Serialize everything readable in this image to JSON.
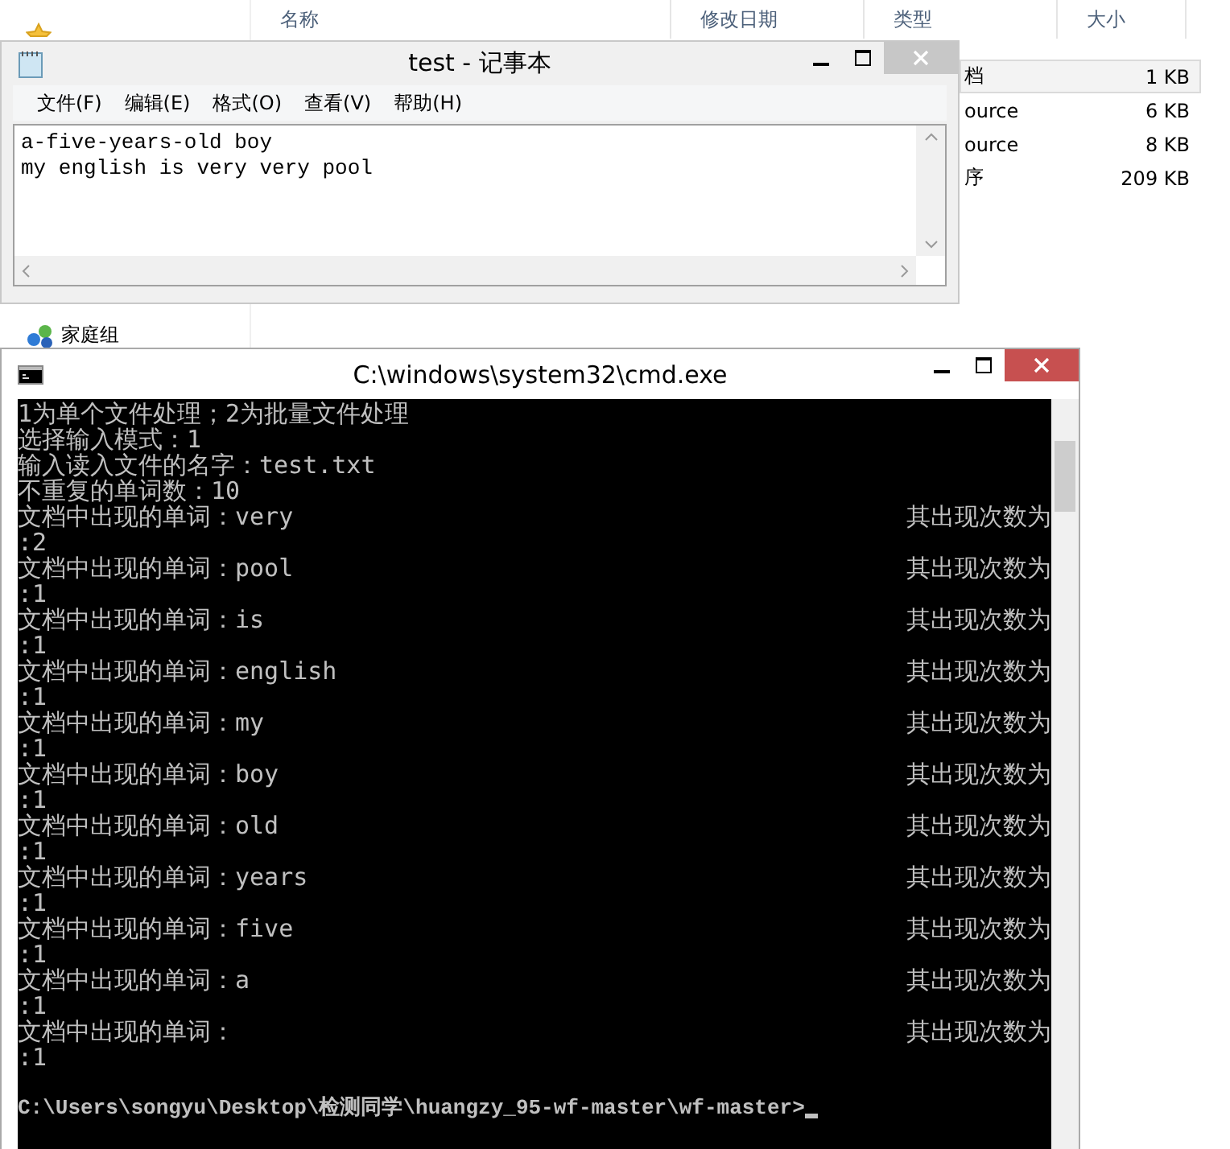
{
  "explorer": {
    "nav": [
      {
        "label": "家庭组",
        "kind": "homegroup"
      }
    ],
    "columns": [
      "名称",
      "修改日期",
      "类型",
      "大小"
    ],
    "rows": [
      {
        "type": "档",
        "size": "1 KB",
        "selected": true
      },
      {
        "type": "ource",
        "size": "6 KB",
        "selected": false
      },
      {
        "type": "ource",
        "size": "8 KB",
        "selected": false
      },
      {
        "type": "序",
        "size": "209 KB",
        "selected": false
      }
    ]
  },
  "notepad": {
    "title": "test - 记事本",
    "menu": [
      "文件(F)",
      "编辑(E)",
      "格式(O)",
      "查看(V)",
      "帮助(H)"
    ],
    "lines": [
      "a-five-years-old boy",
      "my english is very very pool"
    ]
  },
  "console": {
    "title": "C:\\windows\\system32\\cmd.exe",
    "lines": [
      {
        "text": "1为单个文件处理；2为批量文件处理"
      },
      {
        "text": "选择输入模式：1"
      },
      {
        "text": "输入读入文件的名字：test.txt"
      },
      {
        "text": "不重复的单词数：10"
      },
      {
        "text": "文档中出现的单词：very",
        "right": "其出现次数为"
      },
      {
        "text": ":2"
      },
      {
        "text": "文档中出现的单词：pool",
        "right": "其出现次数为"
      },
      {
        "text": ":1"
      },
      {
        "text": "文档中出现的单词：is",
        "right": "其出现次数为"
      },
      {
        "text": ":1"
      },
      {
        "text": "文档中出现的单词：english",
        "right": "其出现次数为"
      },
      {
        "text": ":1"
      },
      {
        "text": "文档中出现的单词：my",
        "right": "其出现次数为"
      },
      {
        "text": ":1"
      },
      {
        "text": "文档中出现的单词：boy",
        "right": "其出现次数为"
      },
      {
        "text": ":1"
      },
      {
        "text": "文档中出现的单词：old",
        "right": "其出现次数为"
      },
      {
        "text": ":1"
      },
      {
        "text": "文档中出现的单词：years",
        "right": "其出现次数为"
      },
      {
        "text": ":1"
      },
      {
        "text": "文档中出现的单词：five",
        "right": "其出现次数为"
      },
      {
        "text": ":1"
      },
      {
        "text": "文档中出现的单词：a",
        "right": "其出现次数为"
      },
      {
        "text": ":1"
      },
      {
        "text": "文档中出现的单词：",
        "right": "其出现次数为"
      },
      {
        "text": ":1"
      }
    ],
    "prompt": "C:\\Users\\songyu\\Desktop\\检测同学\\huangzy_95-wf-master\\wf-master>"
  }
}
